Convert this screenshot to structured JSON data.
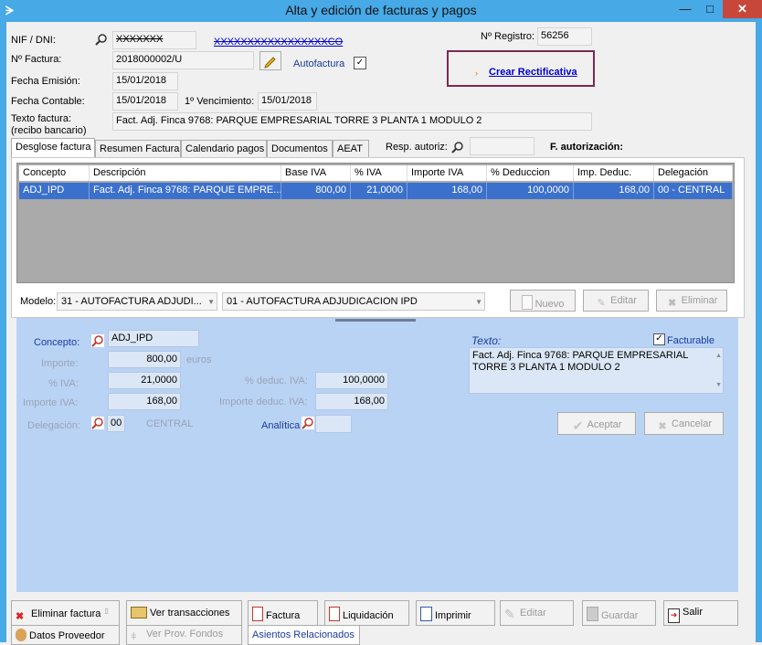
{
  "window": {
    "title": "Alta y edición de facturas y pagos"
  },
  "header": {
    "nif_label": "NIF / DNI:",
    "nif_value": "XXXXXXX",
    "nif_name": "XXXXXXXXXXXXXXXXXCO",
    "registro_label": "Nº Registro:",
    "registro_value": "56256",
    "factura_label": "Nº Factura:",
    "factura_value": "2018000002/U",
    "autofactura_label": "Autofactura",
    "crear_rectificativa": "Crear Rectificativa",
    "fecha_emision_label": "Fecha Emisión:",
    "fecha_emision_value": "15/01/2018",
    "fecha_contable_label": "Fecha Contable:",
    "fecha_contable_value": "15/01/2018",
    "vencimiento_label": "1º Vencimiento:",
    "vencimiento_value": "15/01/2018",
    "texto_factura_label": "Texto factura:",
    "texto_factura_sub": "(recibo bancario)",
    "texto_factura_value": "Fact. Adj. Finca 9768: PARQUE EMPRESARIAL TORRE 3 PLANTA 1 MODULO 2"
  },
  "tabs": [
    "Desglose factura",
    "Resumen Factura",
    "Calendario pagos",
    "Documentos",
    "AEAT"
  ],
  "resp_autoriz_label": "Resp. autoriz:",
  "f_autorizacion_label": "F. autorización:",
  "grid": {
    "columns": [
      "Concepto",
      "Descripción",
      "Base IVA",
      "% IVA",
      "Importe IVA",
      "% Deduccion",
      "Imp. Deduc.",
      "Delegación"
    ],
    "rows": [
      [
        "ADJ_IPD",
        "Fact. Adj. Finca 9768: PARQUE EMPRE...",
        "800,00",
        "21,0000",
        "168,00",
        "100,0000",
        "168,00",
        "00 - CENTRAL"
      ]
    ]
  },
  "modelo": {
    "label": "Modelo:",
    "combo1": "31 - AUTOFACTURA ADJUDI...",
    "combo2": "01 - AUTOFACTURA ADJUDICACION IPD"
  },
  "line_buttons": {
    "nuevo": "Nuevo",
    "editar": "Editar",
    "eliminar": "Eliminar"
  },
  "detail": {
    "concepto_label": "Concepto:",
    "concepto_value": "ADJ_IPD",
    "importe_label": "Importe:",
    "importe_value": "800,00",
    "euros": "euros",
    "iva_label": "% IVA:",
    "iva_value": "21,0000",
    "deduc_label": "% deduc. IVA:",
    "deduc_value": "100,0000",
    "importe_iva_label": "Importe IVA:",
    "importe_iva_value": "168,00",
    "importe_deduc_label": "Importe deduc. IVA:",
    "importe_deduc_value": "168,00",
    "delegacion_label": "Delegación:",
    "delegacion_code": "00",
    "delegacion_name": "CENTRAL",
    "analitica_label": "Analítica",
    "texto_label": "Texto:",
    "facturable_label": "Facturable",
    "texto_value_1": "Fact. Adj. Finca 9768: PARQUE EMPRESARIAL",
    "texto_value_2": "TORRE 3 PLANTA 1 MODULO 2",
    "aceptar": "Aceptar",
    "cancelar": "Cancelar"
  },
  "bottom": {
    "eliminar_factura": "Eliminar factura",
    "ver_transacciones": "Ver transacciones",
    "factura": "Factura",
    "liquidacion": "Liquidación",
    "imprimir": "Imprimir",
    "editar": "Editar",
    "guardar": "Guardar",
    "salir": "Salir",
    "datos_proveedor": "Datos Proveedor",
    "ver_prov_fondos": "Ver Prov. Fondos",
    "asientos_relacionados": "Asientos Relacionados"
  },
  "colors": {
    "titlebar": "#47a9e6",
    "selection": "#3b71cc",
    "panel": "#b9d3f5",
    "close": "#c7483b"
  }
}
